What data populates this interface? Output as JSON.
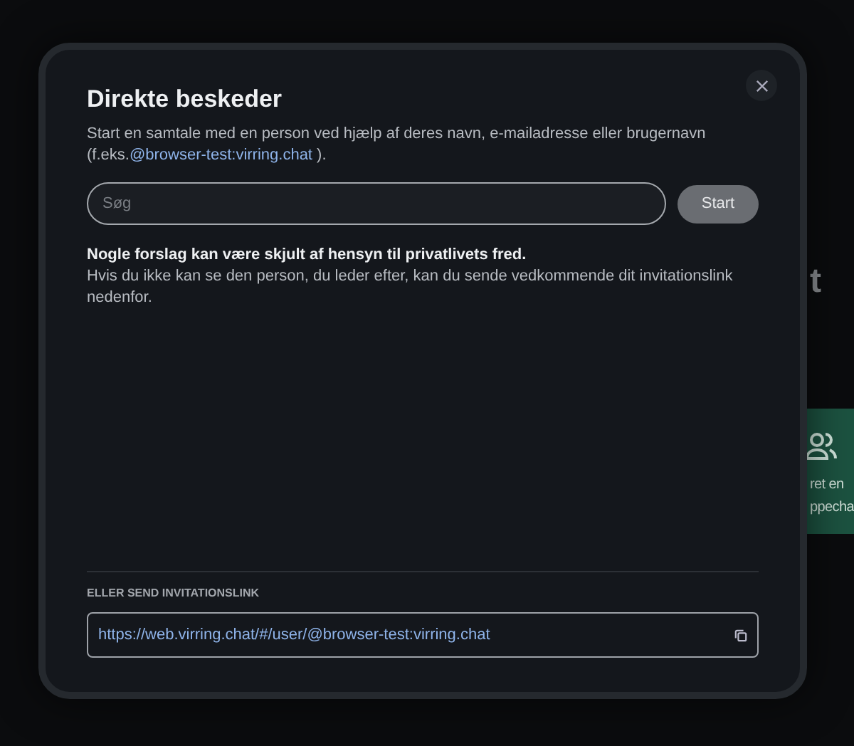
{
  "background": {
    "heading_fragment": "t",
    "tile_lines": [
      "ret en",
      "ppecha"
    ]
  },
  "dialog": {
    "title": "Direkte beskeder",
    "intro": "Start en samtale med en person ved hjælp af deres navn, e-mailadresse eller brugernavn (f.eks.",
    "intro_link": "@browser-test:virring.chat",
    "intro_end": " ).",
    "search": {
      "placeholder": "Søg"
    },
    "start_button": {
      "label": "Start",
      "disabled": true
    },
    "notice_bold": "Nogle forslag kan være skjult af hensyn til privatlivets fred.",
    "notice": "Hvis du ikke kan se den person, du leder efter, kan du sende vedkommende dit invitationslink nedenfor.",
    "invite_heading": "ELLER SEND INVITATIONSLINK",
    "invite_link": "https://web.virring.chat/#/user/@browser-test:virring.chat"
  }
}
